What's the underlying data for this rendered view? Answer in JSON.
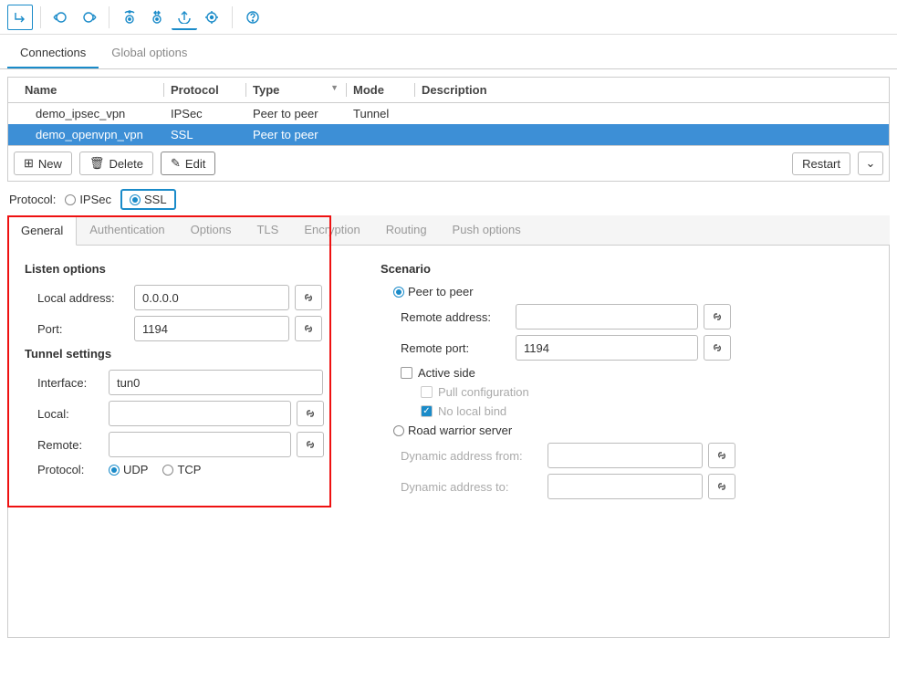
{
  "tabs": {
    "connections": "Connections",
    "global_options": "Global options"
  },
  "grid": {
    "headers": {
      "name": "Name",
      "protocol": "Protocol",
      "type": "Type",
      "mode": "Mode",
      "description": "Description"
    },
    "rows": [
      {
        "name": "demo_ipsec_vpn",
        "protocol": "IPSec",
        "type": "Peer to peer",
        "mode": "Tunnel",
        "description": ""
      },
      {
        "name": "demo_openvpn_vpn",
        "protocol": "SSL",
        "type": "Peer to peer",
        "mode": "",
        "description": ""
      }
    ]
  },
  "actions": {
    "new": "New",
    "delete": "Delete",
    "edit": "Edit",
    "restart": "Restart"
  },
  "protocol": {
    "label": "Protocol:",
    "ipsec": "IPSec",
    "ssl": "SSL"
  },
  "sub_tabs": {
    "general": "General",
    "authentication": "Authentication",
    "options": "Options",
    "tls": "TLS",
    "encryption": "Encryption",
    "routing": "Routing",
    "push": "Push options"
  },
  "listen": {
    "title": "Listen options",
    "local_address": "Local address:",
    "local_address_val": "0.0.0.0",
    "port": "Port:",
    "port_val": "1194"
  },
  "tunnel": {
    "title": "Tunnel settings",
    "interface": "Interface:",
    "interface_val": "tun0",
    "local": "Local:",
    "local_val": "",
    "remote": "Remote:",
    "remote_val": "",
    "protocol": "Protocol:",
    "udp": "UDP",
    "tcp": "TCP"
  },
  "scenario": {
    "title": "Scenario",
    "peer": "Peer to peer",
    "remote_address": "Remote address:",
    "remote_address_val": "",
    "remote_port": "Remote port:",
    "remote_port_val": "1194",
    "active_side": "Active side",
    "pull_config": "Pull configuration",
    "no_local_bind": "No local bind",
    "road_warrior": "Road warrior server",
    "dyn_from": "Dynamic address from:",
    "dyn_from_val": "",
    "dyn_to": "Dynamic address to:",
    "dyn_to_val": ""
  }
}
